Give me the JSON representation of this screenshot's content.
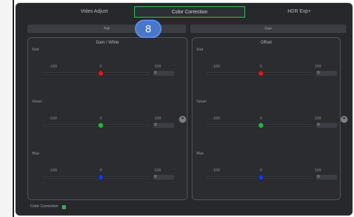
{
  "tabs": [
    {
      "label": "Video Adjust",
      "active": false
    },
    {
      "label": "Color Correction",
      "active": true
    },
    {
      "label": "HDR Exp+",
      "active": false
    }
  ],
  "subtabs": [
    {
      "label": "Hall"
    },
    {
      "label": "Daw"
    }
  ],
  "badge": {
    "number": "8"
  },
  "panels": {
    "gain": {
      "title": "Gain / White",
      "channels": [
        {
          "label": "Red",
          "min": "-100",
          "mid": "0",
          "max": "100",
          "value": "0",
          "color": "#cc1f1f"
        },
        {
          "label": "Green",
          "min": "-100",
          "mid": "0",
          "max": "100",
          "value": "0",
          "color": "#23b14a"
        },
        {
          "label": "Blue",
          "min": "-100",
          "mid": "0",
          "max": "100",
          "value": "0",
          "color": "#1f36d6"
        }
      ]
    },
    "offset": {
      "title": "Offset",
      "channels": [
        {
          "label": "Red",
          "min": "-100",
          "mid": "0",
          "max": "100",
          "value": "0",
          "color": "#cc1f1f"
        },
        {
          "label": "Green",
          "min": "-100",
          "mid": "0",
          "max": "100",
          "value": "0",
          "color": "#23b14a"
        },
        {
          "label": "Blue",
          "min": "-100",
          "mid": "0",
          "max": "100",
          "value": "0",
          "color": "#1f36d6"
        }
      ]
    }
  },
  "footer": {
    "label": "Color Correction",
    "icon": "color-correction-icon"
  },
  "link_icon": "link-icon",
  "colors": {
    "accent": "#35c45a",
    "background": "#26282b",
    "badge": "#4977c7"
  }
}
